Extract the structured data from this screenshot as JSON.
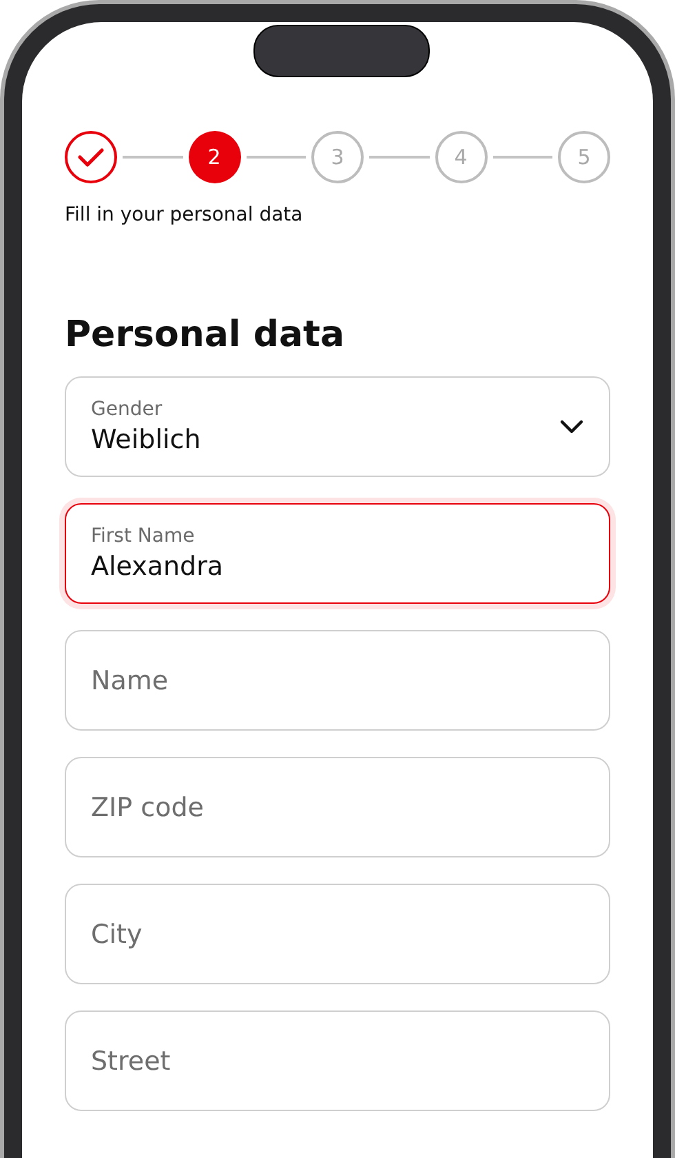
{
  "stepper": {
    "steps": [
      {
        "completed": true,
        "selected": false
      },
      {
        "label": "2",
        "completed": false,
        "selected": true
      },
      {
        "label": "3",
        "completed": false,
        "selected": false
      },
      {
        "label": "4",
        "completed": false,
        "selected": false
      },
      {
        "label": "5",
        "completed": false,
        "selected": false
      }
    ],
    "caption": "Fill in your personal data"
  },
  "title": "Personal data",
  "fields": [
    {
      "kind": "select",
      "label": "Gender",
      "value": "Weiblich",
      "focused": false
    },
    {
      "kind": "text",
      "label": "First Name",
      "value": "Alexandra",
      "focused": true
    },
    {
      "kind": "text",
      "placeholder": "Name",
      "focused": false
    },
    {
      "kind": "text",
      "placeholder": "ZIP code",
      "focused": false
    },
    {
      "kind": "text",
      "placeholder": "City",
      "focused": false
    },
    {
      "kind": "text",
      "placeholder": "Street",
      "focused": false
    }
  ]
}
